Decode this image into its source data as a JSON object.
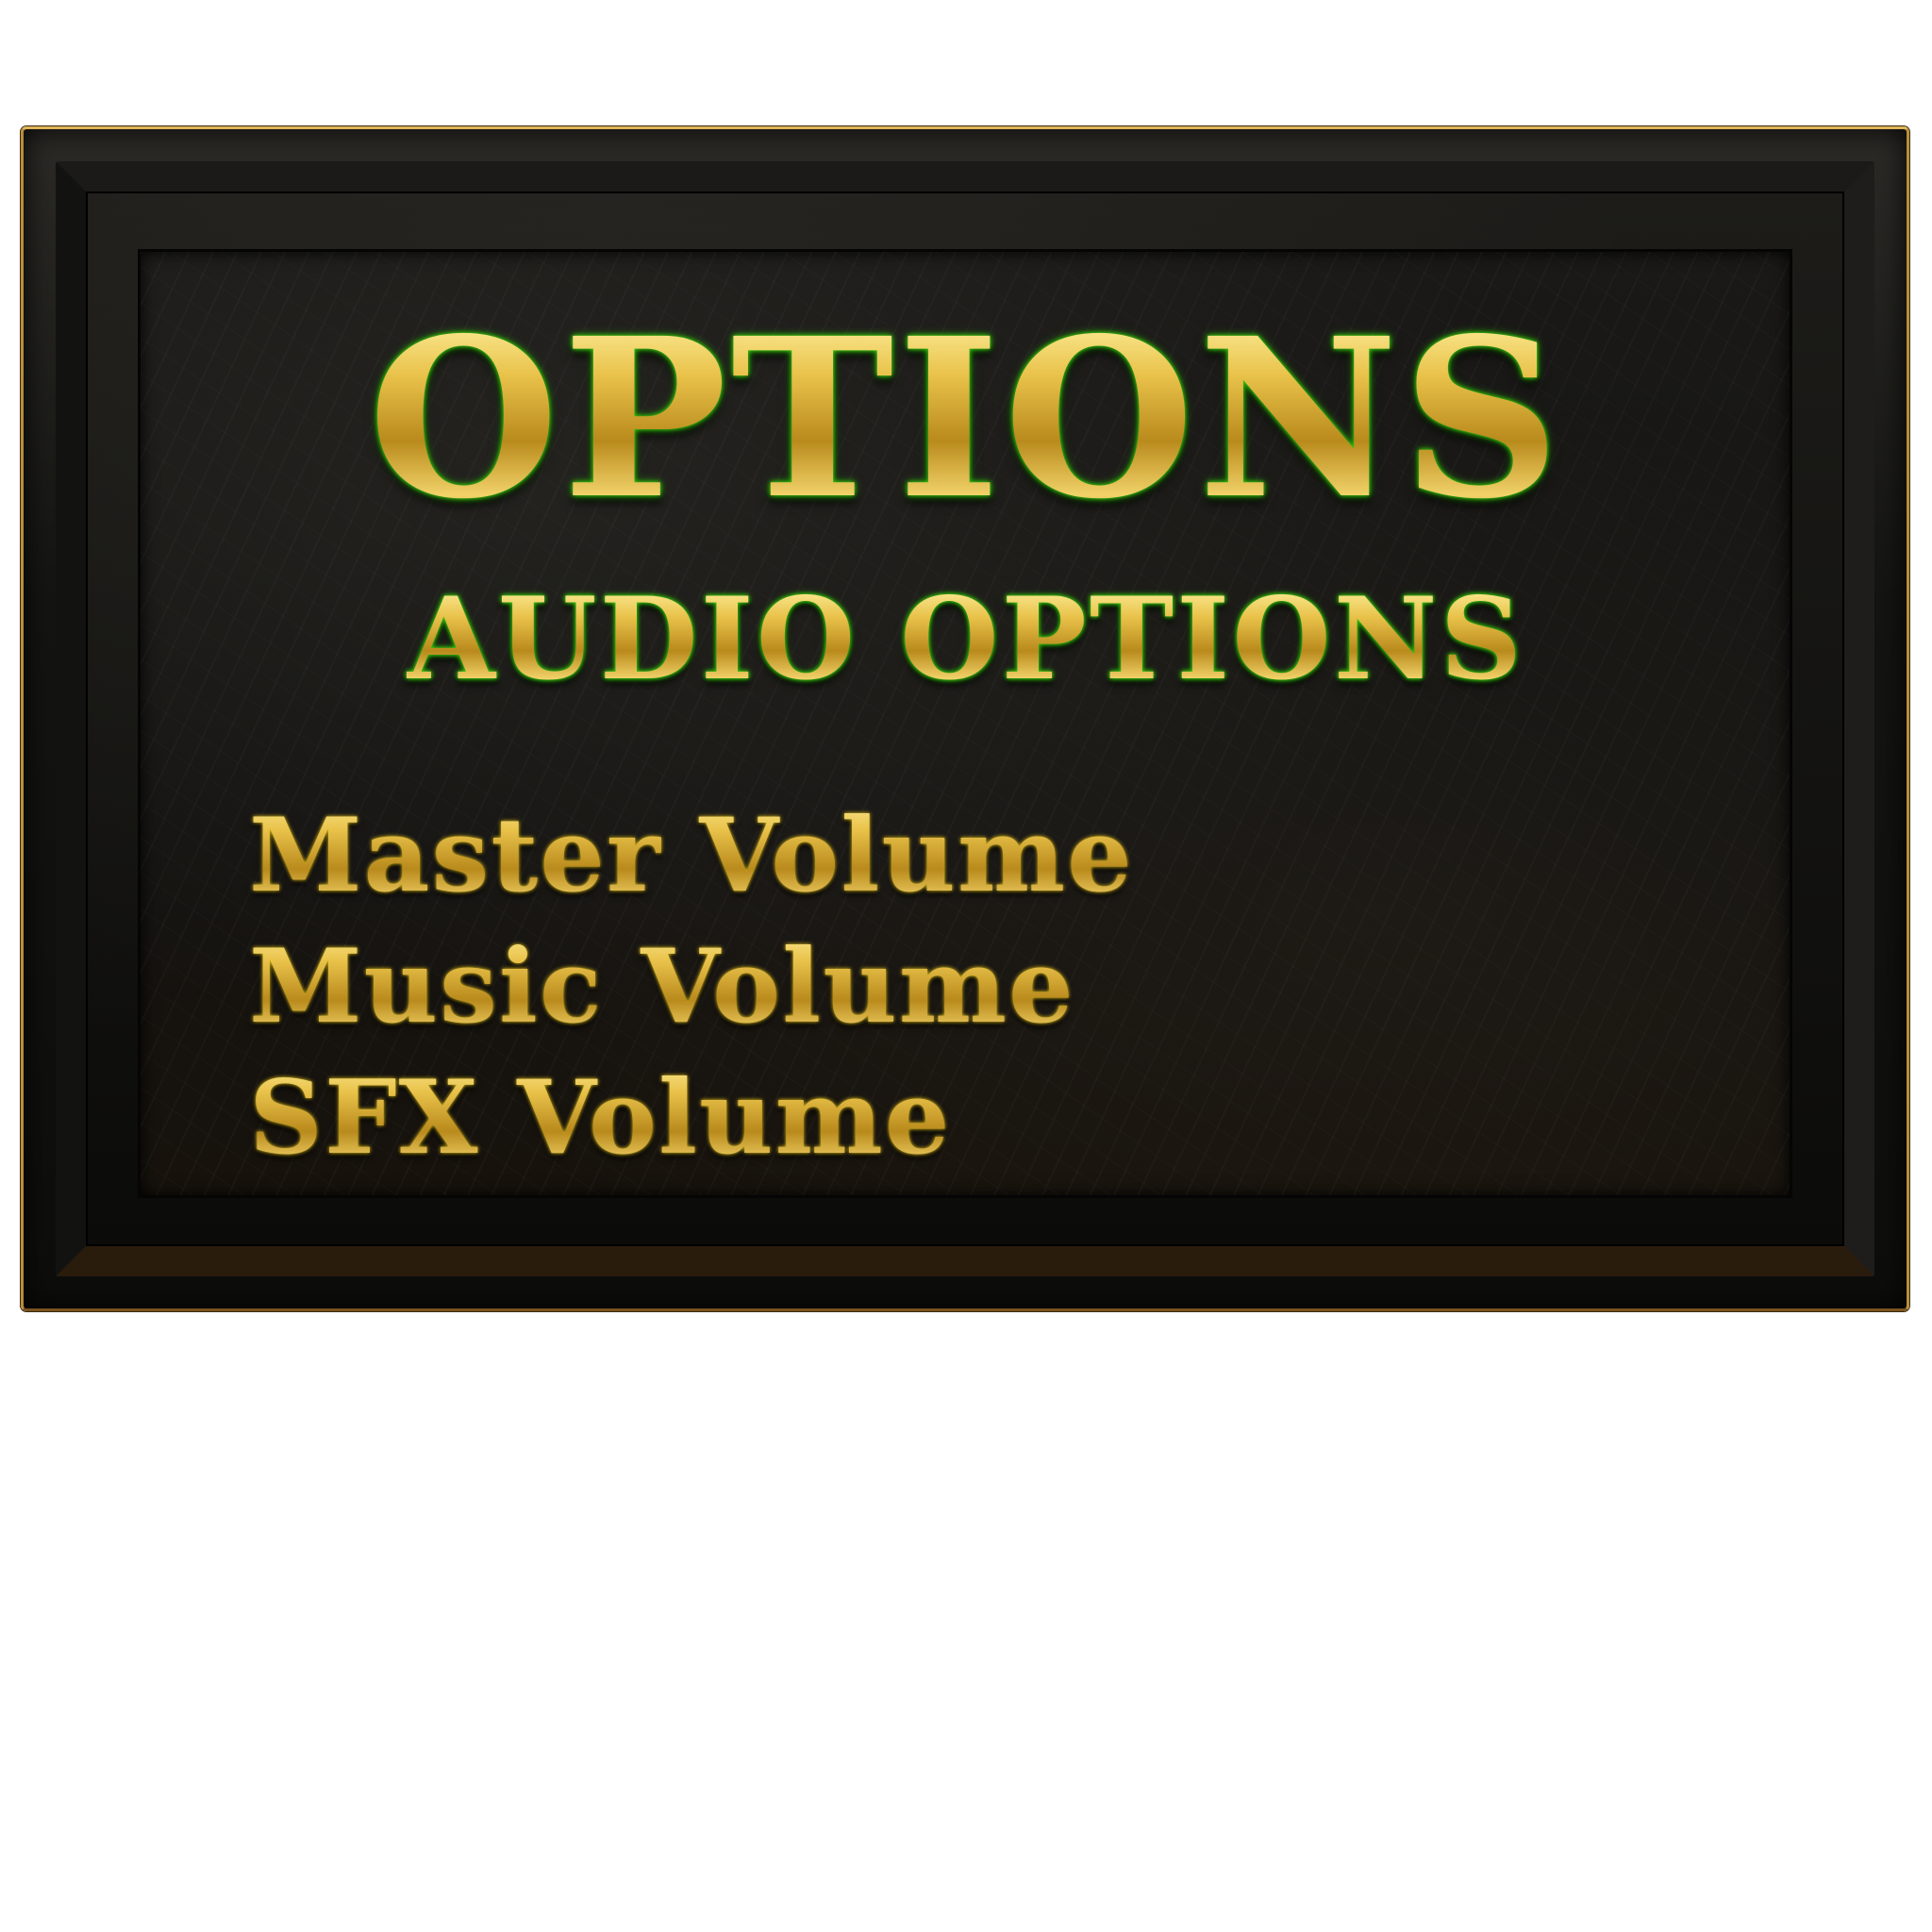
{
  "screen": {
    "title": "OPTIONS",
    "subtitle": "AUDIO OPTIONS"
  },
  "menu": {
    "items": [
      {
        "label": "Master Volume"
      },
      {
        "label": "Music Volume"
      },
      {
        "label": "SFX Volume"
      }
    ]
  },
  "colors": {
    "gold_text": "#e3b93a",
    "title_glow": "#3cd10f",
    "frame_trim": "#b88f3c",
    "panel_background": "#141311",
    "page_background": "#ffffff"
  }
}
